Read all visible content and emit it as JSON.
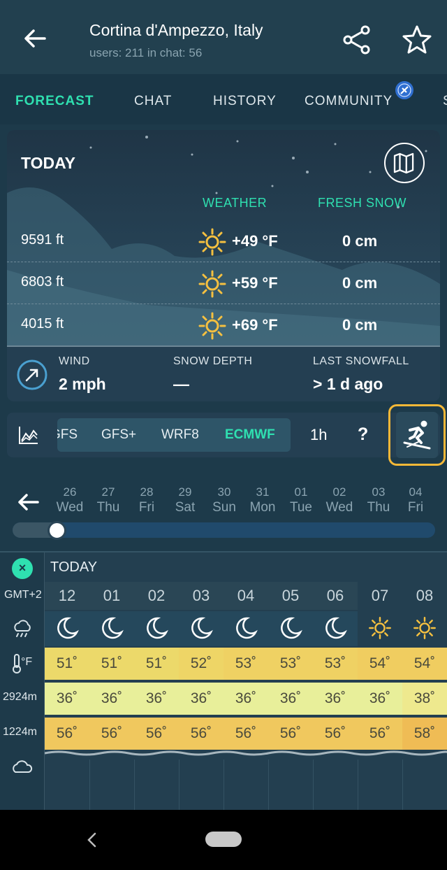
{
  "header": {
    "title": "Cortina d'Ampezzo, Italy",
    "subtitle": "users: 211 in chat: 56"
  },
  "tabs": [
    "FORECAST",
    "CHAT",
    "HISTORY",
    "COMMUNITY",
    "S"
  ],
  "today": {
    "label": "TODAY",
    "col_weather": "WEATHER",
    "col_snow": "FRESH SNOW",
    "rows": [
      {
        "altitude": "9591 ft",
        "temp": "+49 °F",
        "snow": "0 cm",
        "icon": "sun-icon"
      },
      {
        "altitude": "6803 ft",
        "temp": "+59 °F",
        "snow": "0 cm",
        "icon": "sun-icon"
      },
      {
        "altitude": "4015 ft",
        "temp": "+69 °F",
        "snow": "0 cm",
        "icon": "sun-icon"
      }
    ],
    "wind_label": "WIND",
    "wind_value": "2 mph",
    "depth_label": "SNOW DEPTH",
    "depth_value": "—",
    "last_label": "LAST SNOWFALL",
    "last_value": "> 1 d ago"
  },
  "models": {
    "items": [
      "GFS",
      "GFS+",
      "WRF8",
      "ECMWF"
    ],
    "active": "ECMWF",
    "interval": "1h",
    "help": "?"
  },
  "days": [
    {
      "num": "26",
      "wd": "Wed"
    },
    {
      "num": "27",
      "wd": "Thu"
    },
    {
      "num": "28",
      "wd": "Fri"
    },
    {
      "num": "29",
      "wd": "Sat"
    },
    {
      "num": "30",
      "wd": "Sun"
    },
    {
      "num": "31",
      "wd": "Mon"
    },
    {
      "num": "01",
      "wd": "Tue"
    },
    {
      "num": "02",
      "wd": "Wed"
    },
    {
      "num": "03",
      "wd": "Thu"
    },
    {
      "num": "04",
      "wd": "Fri"
    }
  ],
  "table": {
    "today": "TODAY",
    "close": "×",
    "tz": "GMT+2",
    "temp_unit": "°F",
    "row2_label": "2924m",
    "row3_label": "1224m",
    "hours": [
      "12",
      "01",
      "02",
      "03",
      "04",
      "05",
      "06",
      "07",
      "08"
    ],
    "icons": [
      "moon-icon",
      "moon-icon",
      "moon-icon",
      "moon-icon",
      "moon-icon",
      "moon-icon",
      "moon-icon",
      "sun-icon",
      "sun-icon"
    ],
    "temps": [
      "51˚",
      "51˚",
      "51˚",
      "52˚",
      "53˚",
      "53˚",
      "53˚",
      "54˚",
      "54˚"
    ],
    "temps_2924": [
      "36˚",
      "36˚",
      "36˚",
      "36˚",
      "36˚",
      "36˚",
      "36˚",
      "36˚",
      "38˚"
    ],
    "temps_1224": [
      "56˚",
      "56˚",
      "56˚",
      "56˚",
      "56˚",
      "56˚",
      "56˚",
      "56˚",
      "58˚"
    ]
  },
  "colors": {
    "accent": "#2fe0b0",
    "highlight": "#f5b837",
    "temp_row": "#f0df6a",
    "temp_row_2924": "#eef09a",
    "temp_row_1224": "#f0c65a"
  }
}
